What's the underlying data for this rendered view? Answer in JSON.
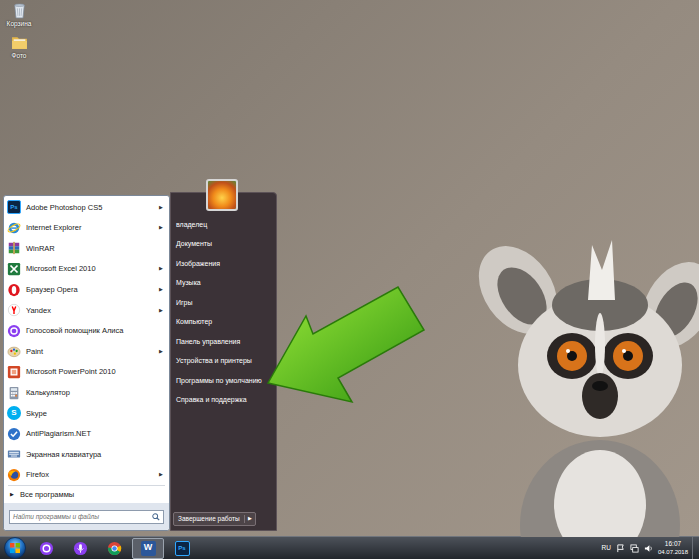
{
  "desktop": {
    "icons": [
      {
        "label": "Корзина",
        "kind": "recycle"
      },
      {
        "label": "Фото",
        "kind": "folder"
      }
    ]
  },
  "start_menu": {
    "submenu_glyph": "▶",
    "programs": [
      {
        "label": "Adobe Photoshop CS5",
        "kind": "photoshop",
        "icon_text": "Ps",
        "submenu": true
      },
      {
        "label": "Internet Explorer",
        "kind": "ie",
        "submenu": true
      },
      {
        "label": "WinRAR",
        "kind": "winrar",
        "submenu": false
      },
      {
        "label": "Microsoft Excel 2010",
        "kind": "excel",
        "submenu": true
      },
      {
        "label": "Браузер Opera",
        "kind": "opera",
        "submenu": true
      },
      {
        "label": "Yandex",
        "kind": "yandex",
        "submenu": true
      },
      {
        "label": "Голосовой помощник Алиса",
        "kind": "alice",
        "submenu": false
      },
      {
        "label": "Paint",
        "kind": "paint",
        "submenu": true
      },
      {
        "label": "Microsoft PowerPoint 2010",
        "kind": "powerpoint",
        "submenu": false
      },
      {
        "label": "Калькулятор",
        "kind": "calculator",
        "submenu": false
      },
      {
        "label": "Skype",
        "kind": "skype",
        "icon_text": "S",
        "submenu": false
      },
      {
        "label": "AntiPlagiarism.NET",
        "kind": "antiplagiarism",
        "submenu": false
      },
      {
        "label": "Экранная клавиатура",
        "kind": "keyboard",
        "submenu": false
      },
      {
        "label": "Firefox",
        "kind": "firefox",
        "submenu": true
      }
    ],
    "all_programs": {
      "label": "Все программы",
      "glyph": "▶"
    },
    "search": {
      "placeholder": "Найти программы и файлы"
    },
    "places": [
      {
        "label": "владелец"
      },
      {
        "label": "Документы"
      },
      {
        "label": "Изображения"
      },
      {
        "label": "Музыка"
      },
      {
        "label": "Игры"
      },
      {
        "label": "Компьютер"
      },
      {
        "label": "Панель управления"
      },
      {
        "label": "Устройства и принтеры"
      },
      {
        "label": "Программы по умолчанию"
      },
      {
        "label": "Справка и поддержка"
      }
    ],
    "shutdown": {
      "label": "Завершение работы",
      "glyph": "▶"
    }
  },
  "taskbar": {
    "pinned": [
      {
        "kind": "alice"
      },
      {
        "kind": "microphone"
      },
      {
        "kind": "chrome"
      },
      {
        "kind": "word",
        "icon_text": "W",
        "selected": true
      },
      {
        "kind": "photoshop",
        "icon_text": "Ps",
        "selected": false
      }
    ],
    "language": "RU",
    "time": "16:07",
    "date": "04.07.2018"
  }
}
